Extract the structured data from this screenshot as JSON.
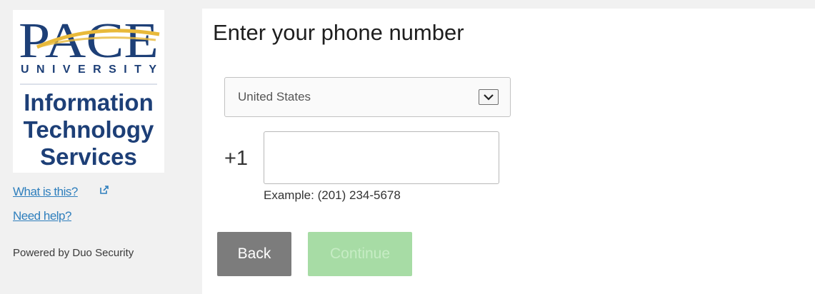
{
  "logo": {
    "wordmark": "PACE",
    "university": "UNIVERSITY",
    "department": [
      "Information",
      "Technology",
      "Services"
    ],
    "navy": "#1d3f77",
    "gold": "#e8b93a"
  },
  "sidebar": {
    "what_is_this": "What is this?",
    "need_help": "Need help?",
    "powered_by": "Powered by Duo Security",
    "link_color": "#2f7fbd"
  },
  "main": {
    "title": "Enter your phone number",
    "country": {
      "selected": "United States"
    },
    "phone": {
      "prefix": "+1",
      "value": "",
      "example": "Example: (201) 234-5678"
    },
    "buttons": {
      "back": "Back",
      "continue": "Continue"
    },
    "continue_enabled": false
  }
}
